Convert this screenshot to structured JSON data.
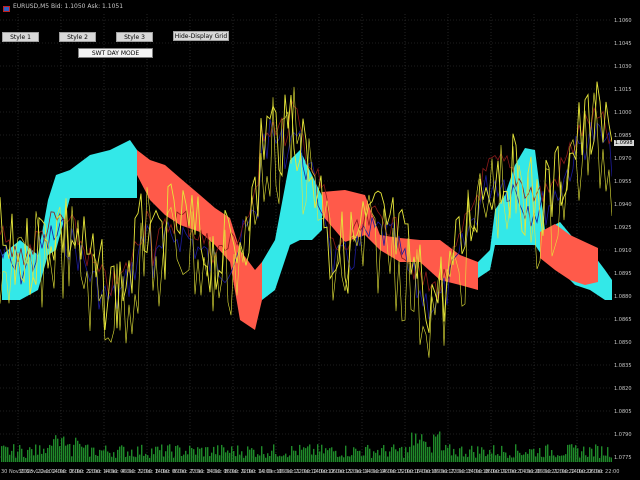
{
  "window": {
    "title": "EURUSD,M5  Bid: 1.1050  Ask: 1.1051",
    "icon": "chart-window-icon"
  },
  "buttons": {
    "style1": "Style 1",
    "style2": "Style 2",
    "style3": "Style 3",
    "grid": "Hide-Display Grid",
    "mode": "SWT DAY MODE"
  },
  "colors": {
    "background": "#000000",
    "grid": "#3c3c3c",
    "cloud_up": "#33e8e8",
    "cloud_down": "#ff5a4a",
    "price_line": "#e6e63a",
    "kijun_line": "#8a1a1a",
    "tenkan_line": "#1c1c9a",
    "volume": "#1f8a2a"
  },
  "price_axis": {
    "labels": [
      "1.1060",
      "1.1045",
      "1.1030",
      "1.1015",
      "1.1000",
      "1.0985",
      "1.0970",
      "1.0955",
      "1.0940",
      "1.0925",
      "1.0910",
      "1.0895",
      "1.0880",
      "1.0865",
      "1.0850",
      "1.0835",
      "1.0820",
      "1.0805",
      "1.0790",
      "1.0775"
    ],
    "current": "1.0998"
  },
  "time_axis": {
    "labels": [
      "30 Nov 2023",
      "30 Nov 22:00",
      "1 Dec 14:00",
      "2 Dec 06:00",
      "2 Dec 22:00",
      "3 Dec 14:00",
      "4 Dec 06:00",
      "4 Dec 22:00",
      "5 Dec 14:00",
      "6 Dec 06:00",
      "6 Dec 22:00",
      "7 Dec 14:00",
      "8 Dec 06:00",
      "8 Dec 22:00",
      "9 Dec 14:00",
      "10 Dec 06:00",
      "10 Dec 22:00",
      "11 Dec 14:00",
      "12 Dec 06:00",
      "12 Dec 22:00",
      "13 Dec 14:00",
      "14 Dec 06:00",
      "14 Dec 22:00",
      "15 Dec 14:00",
      "16 Dec 06:00",
      "16 Dec 22:00",
      "17 Dec 14:00",
      "18 Dec 06:00",
      "18 Dec 22:00",
      "19 Dec 14:00",
      "20 Dec 06:00",
      "20 Dec 22:00",
      "21 Dec 14:00",
      "22 Dec 06:00",
      "22 Dec 22:00"
    ]
  }
}
